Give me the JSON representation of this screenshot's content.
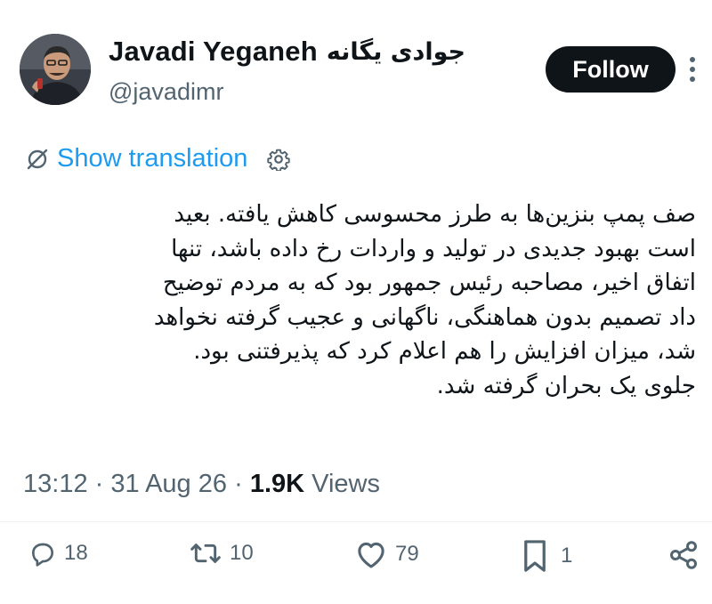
{
  "author": {
    "display_name": "Javadi Yeganeh",
    "display_name_fa": "جوادی یگانه",
    "handle": "@javadimr",
    "avatar_icon": "avatar-icon"
  },
  "header": {
    "follow_label": "Follow",
    "more_icon": "more-vertical-icon"
  },
  "translation": {
    "label": "Show translation",
    "icon": "translate-icon",
    "settings_icon": "gear-icon"
  },
  "tweet": {
    "lines": [
      "صف پمپ بنزین‌ها به طرز محسوسی کاهش یافته. بعید",
      "است بهبود جدیدی در تولید و واردات رخ داده باشد، تنها",
      "اتفاق اخیر، مصاحبه رئیس جمهور بود که  به مردم توضیح",
      "داد تصمیم بدون هماهنگی، ناگهانی و عجیب گرفته نخواهد",
      "شد، میزان افزایش را هم اعلام کرد که پذیرفتنی بود.",
      "جلوی یک بحران گرفته شد."
    ]
  },
  "meta": {
    "time": "13:12",
    "separator": "·",
    "date": "31 Aug 26",
    "views_count": "1.9K",
    "views_label": "Views"
  },
  "actions": {
    "replies": "18",
    "reposts": "10",
    "likes": "79",
    "bookmarks": "1"
  },
  "colors": {
    "accent": "#1d9bf0",
    "text": "#0f1419",
    "muted": "#536471",
    "button_bg": "#0f1419"
  }
}
